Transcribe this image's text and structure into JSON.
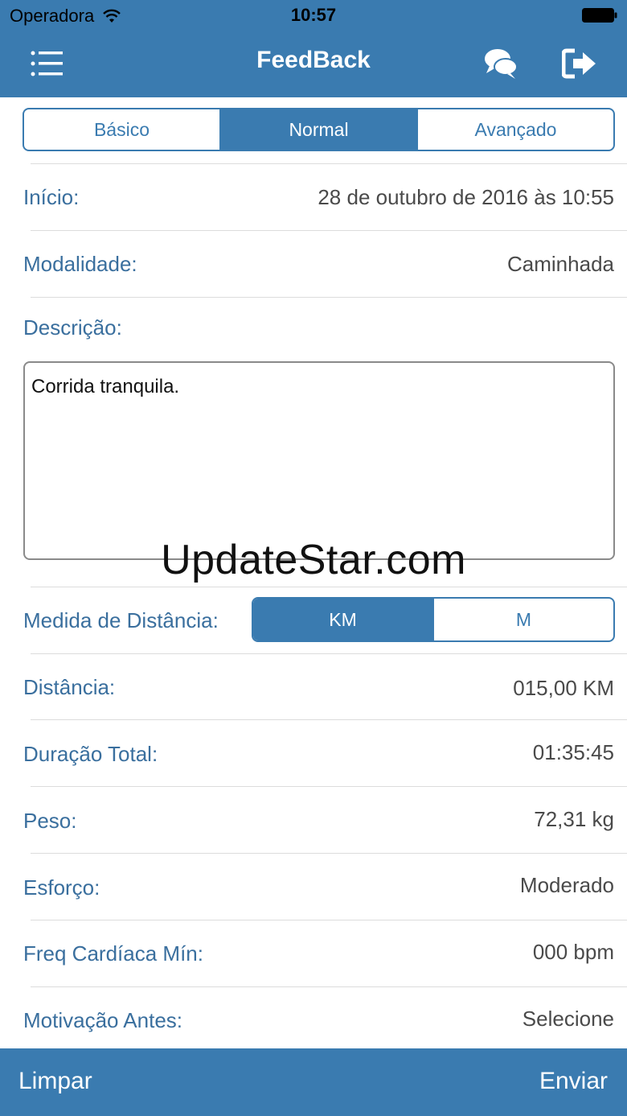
{
  "status_bar": {
    "carrier": "Operadora",
    "time": "10:57"
  },
  "nav": {
    "title": "FeedBack",
    "icons": [
      "menu-icon",
      "chat-icon",
      "logout-icon"
    ]
  },
  "tabs": [
    {
      "label": "Básico",
      "active": false
    },
    {
      "label": "Normal",
      "active": true
    },
    {
      "label": "Avançado",
      "active": false
    }
  ],
  "form": {
    "inicio": {
      "label": "Início:",
      "value": "28 de outubro de 2016 às 10:55"
    },
    "modalidade": {
      "label": "Modalidade:",
      "value": "Caminhada"
    },
    "descricao": {
      "label": "Descrição:",
      "value": "Corrida tranquila."
    },
    "medida": {
      "label": "Medida de Distância:",
      "options": [
        "KM",
        "M"
      ],
      "selected": "KM"
    },
    "distancia": {
      "label": "Distância:",
      "value": "015,00 KM"
    },
    "duracao": {
      "label": "Duração Total:",
      "value": "01:35:45"
    },
    "peso": {
      "label": "Peso:",
      "value": "72,31 kg"
    },
    "esforco": {
      "label": "Esforço:",
      "value": "Moderado"
    },
    "freq": {
      "label": "Freq Cardíaca Mín:",
      "value": "000 bpm"
    },
    "motivacao": {
      "label": "Motivação Antes:",
      "value": "Selecione"
    }
  },
  "watermark": "UpdateStar.com",
  "bottom": {
    "left_label": "Limpar",
    "right_label": "Enviar"
  },
  "colors": {
    "primary": "#3a7bb0",
    "label": "#3a6f9e",
    "value": "#4a4a4a"
  }
}
